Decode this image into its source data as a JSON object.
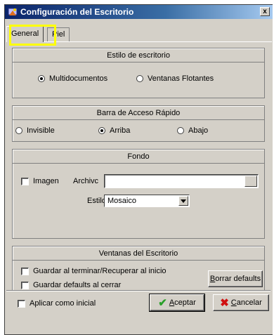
{
  "window": {
    "title": "Configuración del Escritorio",
    "close_glyph": "x"
  },
  "tabs": [
    {
      "label": "General",
      "active": true,
      "highlighted": true
    },
    {
      "label": "Piel",
      "active": false
    }
  ],
  "desktop_style": {
    "title": "Estilo de escritorio",
    "options": [
      {
        "label": "Multidocumentos",
        "selected": true
      },
      {
        "label": "Ventanas Flotantes",
        "selected": false
      }
    ]
  },
  "quick_access": {
    "title": "Barra de Acceso Rápido",
    "options": [
      {
        "label": "Invisible",
        "selected": false
      },
      {
        "label": "Arriba",
        "selected": true
      },
      {
        "label": "Abajo",
        "selected": false
      }
    ]
  },
  "background": {
    "title": "Fondo",
    "image_label": "Imagen",
    "image_checked": false,
    "file_label": "Archivc",
    "file_value": "",
    "style_label": "Estilo",
    "style_value": "Mosaico"
  },
  "desktop_windows": {
    "title": "Ventanas del Escritorio",
    "save_restore_label": "Guardar al terminar/Recuperar al inicio",
    "save_defaults_label": "Guardar defaults al cerrar",
    "reset_button_prefix": "",
    "reset_button_mnemonic": "B",
    "reset_button_rest": "orrar defaults"
  },
  "footer": {
    "apply_initial_label": "Aplicar como inicial",
    "accept_mnemonic": "A",
    "accept_rest": "ceptar",
    "cancel_mnemonic": "C",
    "cancel_rest": "ancelar"
  },
  "icons": {
    "app": "configuration-icon",
    "accept": "checkmark-icon",
    "cancel": "x-icon"
  },
  "colors": {
    "titlebar_start": "#0a246a",
    "titlebar_end": "#a6caf0",
    "tab_highlight": "#ffff00",
    "accept_icon": "#2aa02a",
    "cancel_icon": "#d01010"
  }
}
